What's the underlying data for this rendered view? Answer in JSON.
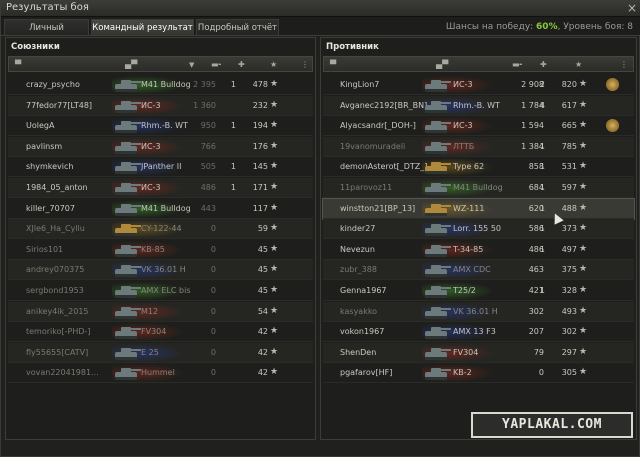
{
  "window": {
    "title": "Результаты боя"
  },
  "tabs": [
    {
      "label": "Личный результат",
      "active": false
    },
    {
      "label": "Командный результат",
      "active": true
    },
    {
      "label": "Подробный отчёт",
      "active": false
    }
  ],
  "win_chance": {
    "prefix": "Шансы на победу: ",
    "percent": "60%",
    "level_text": ", Уровень боя: 8"
  },
  "allies": {
    "title": "Союзники",
    "rows": [
      {
        "player": "crazy_psycho",
        "tank": "M41 Bulldog",
        "damage": "2 395",
        "kills": "1",
        "xp": "478",
        "nation": "green",
        "dead": false
      },
      {
        "player": "77fedor77[LT48]",
        "tank": "ИС-3",
        "damage": "1 360",
        "kills": "",
        "xp": "232",
        "nation": "red",
        "dead": false
      },
      {
        "player": "UolegA",
        "tank": "Rhm.-B. WT",
        "damage": "950",
        "kills": "1",
        "xp": "194",
        "nation": "blue",
        "dead": false
      },
      {
        "player": "pavlinsm",
        "tank": "ИС-3",
        "damage": "766",
        "kills": "",
        "xp": "176",
        "nation": "red",
        "dead": false
      },
      {
        "player": "shymkevich",
        "tank": "JPanther II",
        "damage": "505",
        "kills": "1",
        "xp": "145",
        "nation": "blue",
        "dead": false
      },
      {
        "player": "1984_05_anton",
        "tank": "ИС-3",
        "damage": "486",
        "kills": "1",
        "xp": "171",
        "nation": "red",
        "dead": false
      },
      {
        "player": "killer_70707",
        "tank": "M41 Bulldog",
        "damage": "443",
        "kills": "",
        "xp": "117",
        "nation": "green",
        "dead": false
      },
      {
        "player": "XJle6_Ha_Cyllu",
        "tank": "CY-122-44",
        "damage": "0",
        "kills": "",
        "xp": "59",
        "nation": "gold",
        "dead": true
      },
      {
        "player": "Sirios101",
        "tank": "KB-85",
        "damage": "0",
        "kills": "",
        "xp": "45",
        "nation": "red",
        "dead": true
      },
      {
        "player": "andrey070375",
        "tank": "VK 36.01 H",
        "damage": "0",
        "kills": "",
        "xp": "45",
        "nation": "blue",
        "dead": true
      },
      {
        "player": "sergbond1953",
        "tank": "AMX ELC bis",
        "damage": "0",
        "kills": "",
        "xp": "45",
        "nation": "green",
        "dead": true
      },
      {
        "player": "anikey4ik_2015",
        "tank": "M12",
        "damage": "0",
        "kills": "",
        "xp": "54",
        "nation": "red",
        "dead": true
      },
      {
        "player": "temoriko[-PHD-]",
        "tank": "FV304",
        "damage": "0",
        "kills": "",
        "xp": "42",
        "nation": "red",
        "dead": true
      },
      {
        "player": "fly55655[CATV]",
        "tank": "E 25",
        "damage": "0",
        "kills": "",
        "xp": "42",
        "nation": "blue",
        "dead": true
      },
      {
        "player": "vovan22041981...",
        "tank": "Hummel",
        "damage": "0",
        "kills": "",
        "xp": "42",
        "nation": "red",
        "dead": true
      }
    ]
  },
  "enemies": {
    "title": "Противник",
    "rows": [
      {
        "player": "KingLion7",
        "tank": "ИС-3",
        "damage": "2 908",
        "kills": "2",
        "xp": "820",
        "nation": "red",
        "dead": false,
        "medal": true
      },
      {
        "player": "Avganec2192[BR_BN]",
        "tank": "Rhm.-B. WT",
        "damage": "1 784",
        "kills": "4",
        "xp": "617",
        "nation": "blue",
        "dead": false,
        "medal": false
      },
      {
        "player": "Alyacsandr[_DOH-]",
        "tank": "ИС-3",
        "damage": "1 594",
        "kills": "",
        "xp": "665",
        "nation": "red",
        "dead": false,
        "medal": true
      },
      {
        "player": "19vanomuradeli",
        "tank": "ЛТТБ",
        "damage": "1 384",
        "kills": "1",
        "xp": "785",
        "nation": "red",
        "dead": true,
        "medal": false
      },
      {
        "player": "demonAsterot[_DTZ_]",
        "tank": "Type 62",
        "damage": "858",
        "kills": "1",
        "xp": "531",
        "nation": "gold",
        "dead": false,
        "medal": false
      },
      {
        "player": "11parovoz11",
        "tank": "M41 Bulldog",
        "damage": "684",
        "kills": "1",
        "xp": "597",
        "nation": "green",
        "dead": true,
        "medal": false
      },
      {
        "player": "winstton21[BP_13]",
        "tank": "WZ-111",
        "damage": "620",
        "kills": "1",
        "xp": "488",
        "nation": "gold",
        "dead": false,
        "medal": false,
        "selected": true
      },
      {
        "player": "kinder27",
        "tank": "Lorr. 155 50",
        "damage": "586",
        "kills": "1",
        "xp": "373",
        "nation": "blue",
        "dead": false,
        "medal": false
      },
      {
        "player": "Nevezun",
        "tank": "T-34-85",
        "damage": "486",
        "kills": "1",
        "xp": "497",
        "nation": "red",
        "dead": false,
        "medal": false
      },
      {
        "player": "zubr_388",
        "tank": "AMX CDC",
        "damage": "463",
        "kills": "",
        "xp": "375",
        "nation": "blue",
        "dead": true,
        "medal": false
      },
      {
        "player": "Genna1967",
        "tank": "T25/2",
        "damage": "421",
        "kills": "1",
        "xp": "328",
        "nation": "green",
        "dead": false,
        "medal": false
      },
      {
        "player": "kasyakko",
        "tank": "VK 36.01 H",
        "damage": "302",
        "kills": "",
        "xp": "493",
        "nation": "blue",
        "dead": true,
        "medal": false
      },
      {
        "player": "vokon1967",
        "tank": "AMX 13 F3",
        "damage": "207",
        "kills": "",
        "xp": "302",
        "nation": "blue",
        "dead": false,
        "medal": false
      },
      {
        "player": "ShenDen",
        "tank": "FV304",
        "damage": "79",
        "kills": "",
        "xp": "297",
        "nation": "red",
        "dead": false,
        "medal": false
      },
      {
        "player": "pgafarov[HF]",
        "tank": "KB-2",
        "damage": "0",
        "kills": "",
        "xp": "305",
        "nation": "red",
        "dead": false,
        "medal": false
      }
    ]
  },
  "watermark": "YAPLAKAL.COM"
}
